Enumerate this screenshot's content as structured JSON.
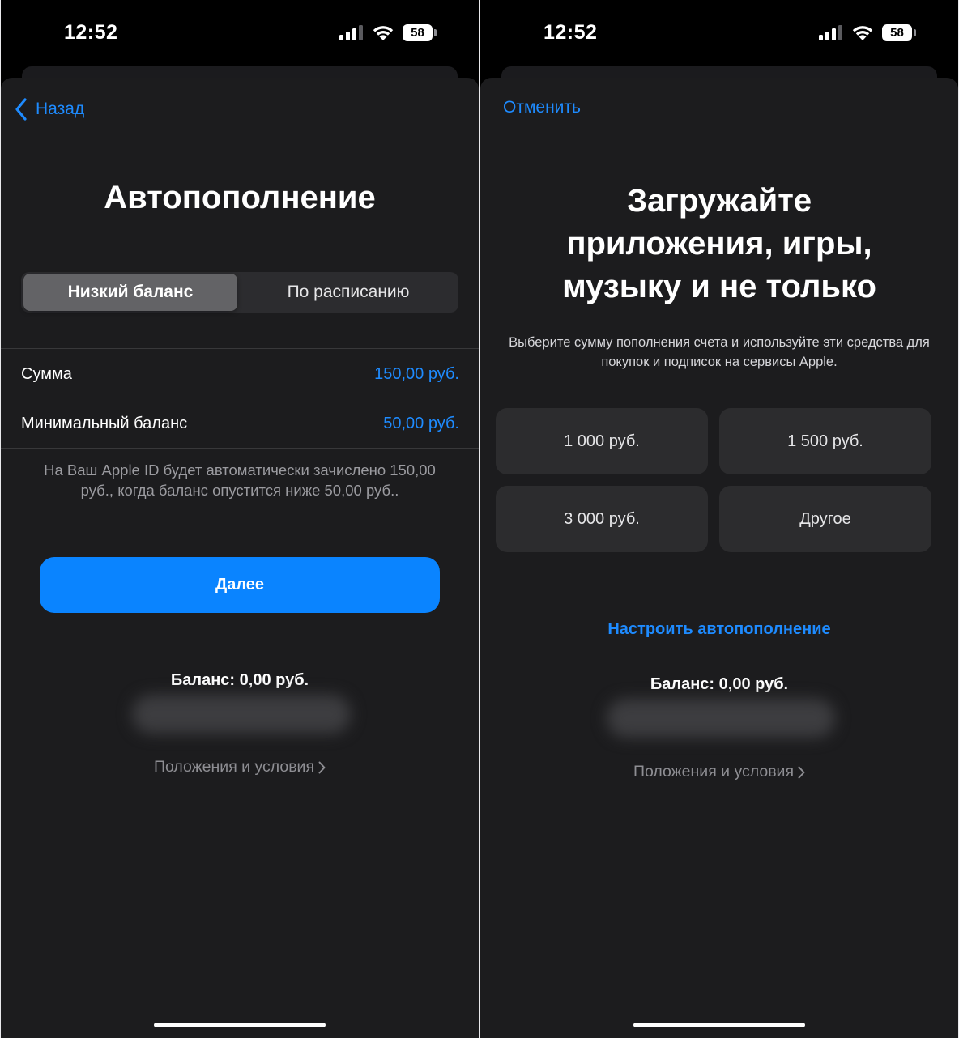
{
  "left_screen": {
    "status": {
      "time": "12:52",
      "battery": "58"
    },
    "nav": {
      "back_label": "Назад"
    },
    "title": "Автопополнение",
    "segmented": {
      "option_low_balance": "Низкий баланс",
      "option_schedule": "По расписанию"
    },
    "rows": [
      {
        "label": "Сумма",
        "value": "150,00 руб."
      },
      {
        "label": "Минимальный баланс",
        "value": "50,00 руб."
      }
    ],
    "info_text": "На Ваш Apple ID будет автоматически зачислено 150,00 руб., когда баланс опустится ниже 50,00 руб..",
    "next_button": "Далее",
    "balance": "Баланс: 0,00 руб.",
    "terms_link": "Положения и условия"
  },
  "right_screen": {
    "status": {
      "time": "12:52",
      "battery": "58"
    },
    "nav": {
      "cancel_label": "Отменить"
    },
    "title_lines": [
      "Загружайте",
      "приложения, игры,",
      "музыку и не только"
    ],
    "subtitle": "Выберите сумму пополнения счета и используйте эти средства для покупок и подписок на сервисы Apple.",
    "amounts": [
      "1 000 руб.",
      "1 500 руб.",
      "3 000 руб.",
      "Другое"
    ],
    "autotopup_link": "Настроить автопополнение",
    "balance": "Баланс: 0,00 руб.",
    "terms_link": "Положения и условия"
  },
  "colors": {
    "accent": "#0a84ff",
    "link": "#1e8bff",
    "sheet": "#1c1c1e",
    "control": "#2c2c2e"
  }
}
